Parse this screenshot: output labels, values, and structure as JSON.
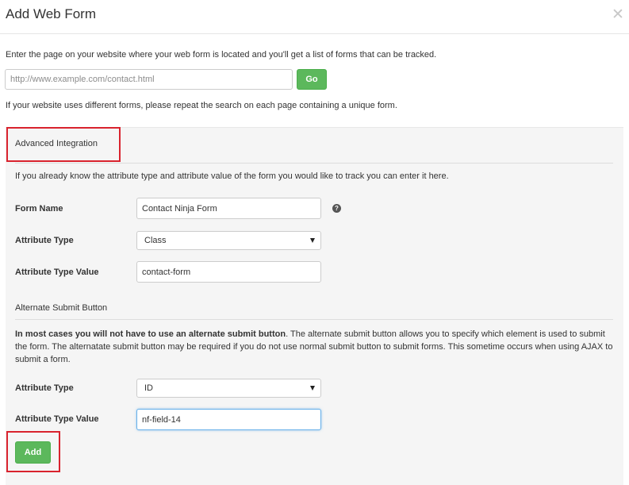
{
  "modal": {
    "title": "Add Web Form",
    "close_glyph": "✕"
  },
  "intro": {
    "text": "Enter the page on your website where your web form is located and you'll get a list of forms that can be tracked."
  },
  "url_search": {
    "placeholder": "http://www.example.com/contact.html",
    "value": "",
    "go_label": "Go"
  },
  "repeat_note": "If your website uses different forms, please repeat the search on each page containing a unique form.",
  "advanced": {
    "heading": "Advanced Integration",
    "help_text": "If you already know the attribute type and attribute value of the form you would like to track you can enter it here.",
    "form_name_label": "Form Name",
    "form_name_value": "Contact Ninja Form",
    "help_icon": "question-circle-icon",
    "attribute_type_label": "Attribute Type",
    "attribute_type_value": "Class",
    "attribute_type_value_label": "Attribute Type Value",
    "attribute_type_value_value": "contact-form"
  },
  "alternate_submit": {
    "heading": "Alternate Submit Button",
    "bold_intro": "In most cases you will not have to use an alternate submit button",
    "body": ". The alternate submit button allows you to specify which element is used to submit the form. The alternatate submit button may be required if you do not use normal submit button to submit forms. This sometime occurs when using AJAX to submit a form.",
    "attribute_type_label": "Attribute Type",
    "attribute_type_value": "ID",
    "attribute_type_value_label": "Attribute Type Value",
    "attribute_type_value_value": "nf-field-14"
  },
  "add_button_label": "Add",
  "colors": {
    "primary_green": "#5cb85c",
    "highlight_red": "#d9232e",
    "panel_bg": "#f5f5f5",
    "focus_blue": "#66afe9"
  }
}
